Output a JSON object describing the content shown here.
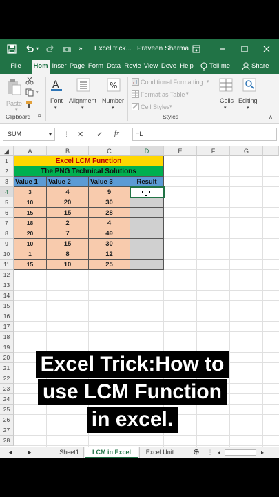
{
  "window": {
    "quick_access_more": "»",
    "title": "Excel trick...",
    "user": "Praveen Sharma",
    "brand_color": "#217346"
  },
  "tabs": [
    "File",
    "Hom",
    "Inser",
    "Page",
    "Form",
    "Data",
    "Revie",
    "View",
    "Deve",
    "Help"
  ],
  "tell_me": "Tell me",
  "share": "Share",
  "ribbon": {
    "paste": "Paste",
    "clipboard": "Clipboard",
    "font": "Font",
    "alignment": "Alignment",
    "number": "Number",
    "conditional_formatting": "Conditional Formatting",
    "format_as_table": "Format as Table",
    "cell_styles": "Cell Styles",
    "styles": "Styles",
    "cells": "Cells",
    "editing": "Editing"
  },
  "formula_bar": {
    "name_box": "SUM",
    "cancel": "✕",
    "enter": "✓",
    "fx": "fx",
    "formula": "=L"
  },
  "columns": [
    "A",
    "B",
    "C",
    "D",
    "E",
    "F",
    "G"
  ],
  "rows": [
    "1",
    "2",
    "3",
    "4",
    "5",
    "6",
    "7",
    "8",
    "9",
    "10",
    "11",
    "12",
    "13",
    "14",
    "15",
    "16",
    "17",
    "18",
    "19",
    "20",
    "21",
    "22",
    "23",
    "24",
    "25",
    "26",
    "27",
    "28"
  ],
  "sheet": {
    "title": "Excel LCM Function",
    "subtitle": "The PNG Technical Solutions",
    "headers": [
      "Value 1",
      "Value 2",
      "Value 3",
      "Result"
    ],
    "data": [
      [
        "3",
        "4",
        "9"
      ],
      [
        "10",
        "20",
        "30"
      ],
      [
        "15",
        "15",
        "28"
      ],
      [
        "18",
        "2",
        "4"
      ],
      [
        "20",
        "7",
        "49"
      ],
      [
        "10",
        "15",
        "30"
      ],
      [
        "1",
        "8",
        "12"
      ],
      [
        "15",
        "10",
        "25"
      ]
    ],
    "colors": {
      "title_bg": "#ffd700",
      "title_fg": "#c00000",
      "subtitle_bg": "#00b050",
      "header_bg": "#5b9bd5",
      "data_bg": "#f8cbad",
      "result_bg": "#d0d0d0"
    }
  },
  "caption": [
    "Excel Trick:How to",
    "use LCM Function",
    "in excel."
  ],
  "sheet_tabs": {
    "prev": "◂",
    "next": "▸",
    "more": "...",
    "tabs": [
      "Sheet1",
      "LCM in Excel",
      "Excel Unit"
    ],
    "add": "⊕"
  }
}
